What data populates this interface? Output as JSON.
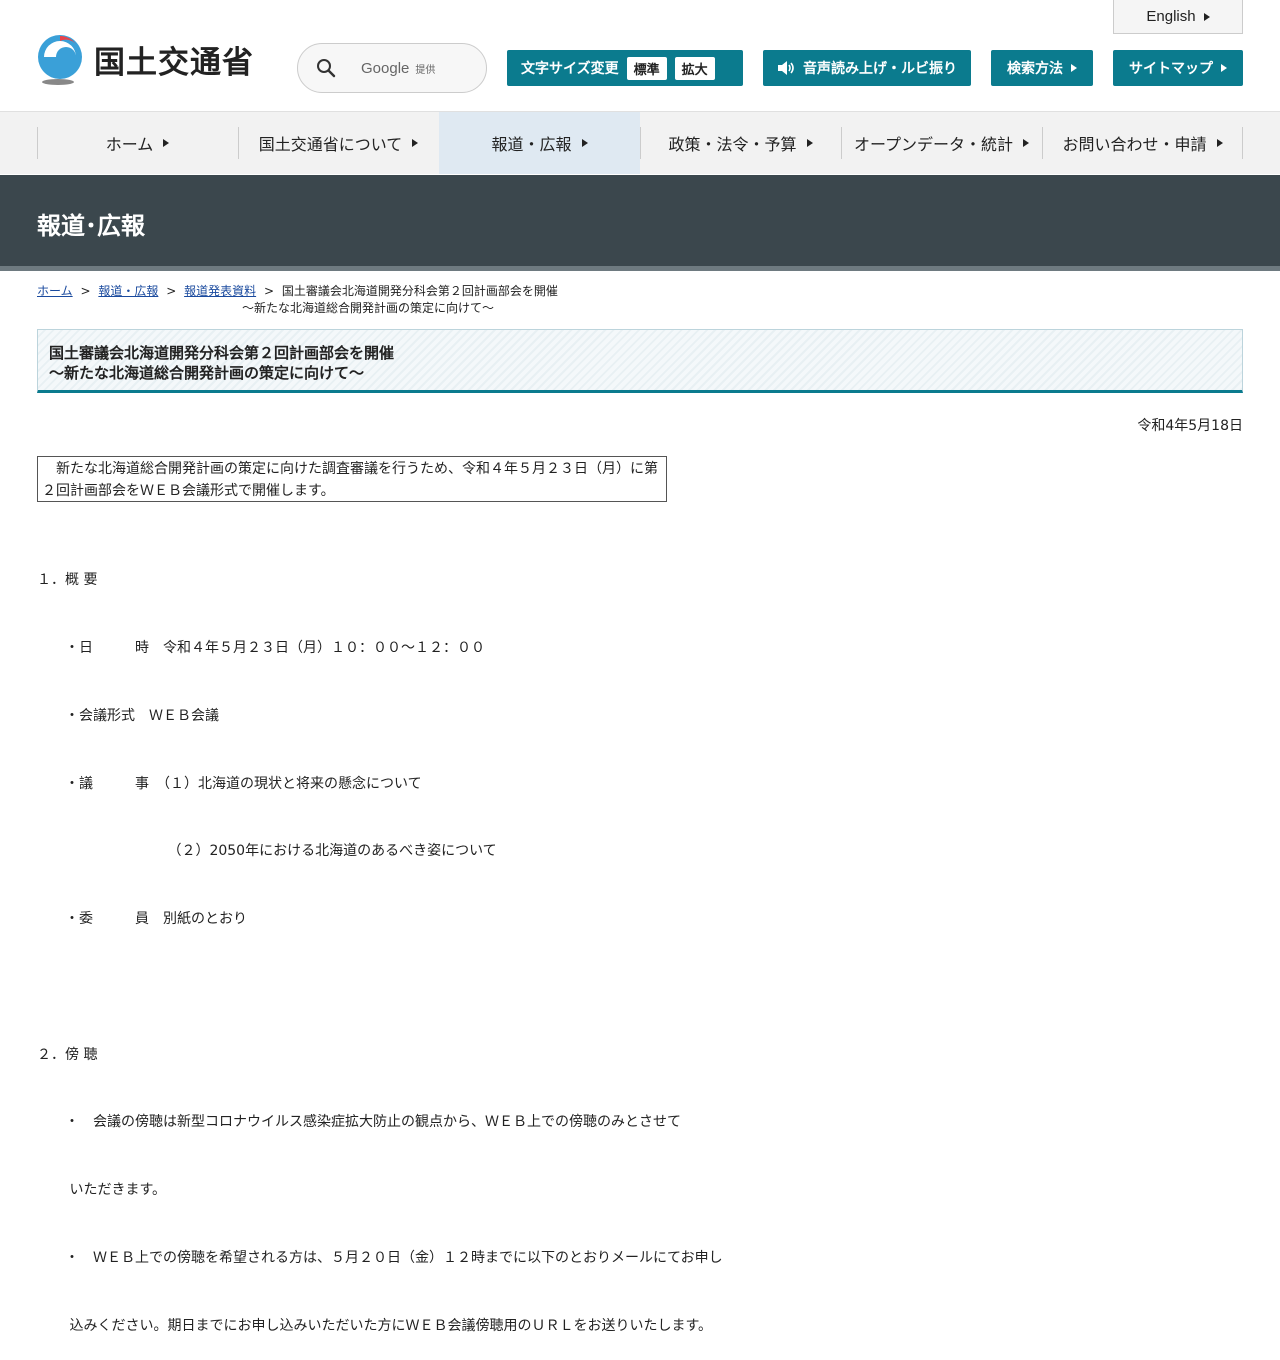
{
  "header": {
    "logo_text": "国土交通省",
    "search": {
      "engine": "Google",
      "provided": "提供"
    },
    "english_label": "English",
    "font_size": {
      "label": "文字サイズ変更",
      "standard": "標準",
      "large": "拡大"
    },
    "voice_label": "音声読み上げ・ルビ振り",
    "search_method_label": "検索方法",
    "sitemap_label": "サイトマップ",
    "accent_color": "#0b7b8e"
  },
  "nav": {
    "items": [
      {
        "label": "ホーム"
      },
      {
        "label": "国土交通省について"
      },
      {
        "label": "報道・広報"
      },
      {
        "label": "政策・法令・予算"
      },
      {
        "label": "オープンデータ・統計"
      },
      {
        "label": "お問い合わせ・申請"
      }
    ]
  },
  "section": {
    "title": "報道･広報"
  },
  "breadcrumb": {
    "home": "ホーム",
    "press": "報道・広報",
    "releases": "報道発表資料",
    "current_line1": "国土審議会北海道開発分科会第２回計画部会を開催",
    "current_line2": "～新たな北海道総合開発計画の策定に向けて～",
    "sep": ">"
  },
  "article": {
    "title_line1": "国土審議会北海道開発分科会第２回計画部会を開催",
    "title_line2": "～新たな北海道総合開発計画の策定に向けて～",
    "date": "令和4年5月18日",
    "lead_line1": "　新たな北海道総合開発計画の策定に向けた調査審議を行うため、令和４年５月２３日（月）に第",
    "lead_line2": "２回計画部会をＷＥＢ会議形式で開催します。",
    "body_lines": [
      "１．概 要",
      "　　・日　　　時　令和４年５月２３日（月）１０：００～１２：００",
      "　　・会議形式　ＷＥＢ会議",
      "　　・議　　　事　（１）北海道の現状と将来の懸念について",
      "　　　　　　　　　 （２）2050年における北海道のあるべき姿について",
      "　　・委　　　員　別紙のとおり",
      "",
      "２．傍 聴",
      "　　・　会議の傍聴は新型コロナウイルス感染症拡大防止の観点から、ＷＥＢ上での傍聴のみとさせて",
      "　　 いただきます。",
      "　　・　ＷＥＢ上での傍聴を希望される方は、５月２０日（金）１２時までに以下のとおりメールにてお申し",
      "　　 込みください。期日までにお申し込みいただいた方にＷＥＢ会議傍聴用のＵＲＬをお送りいたします。"
    ]
  }
}
